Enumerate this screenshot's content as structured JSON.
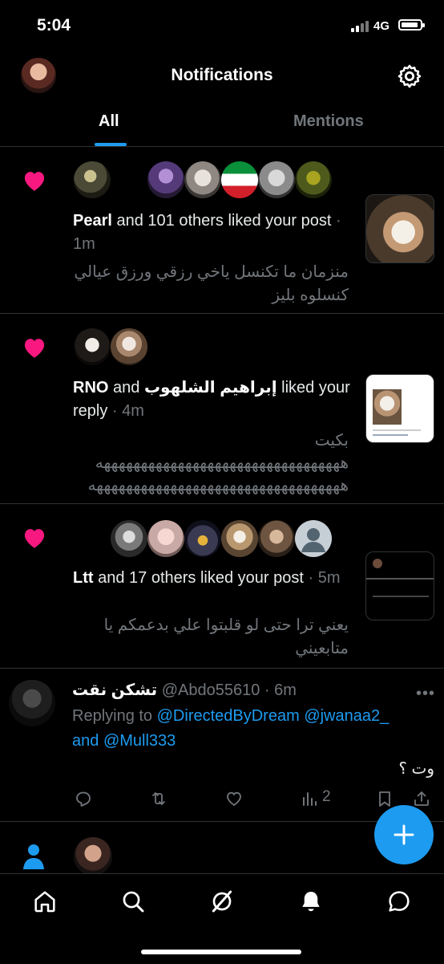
{
  "status_bar": {
    "time": "5:04",
    "network": "4G",
    "battery_level": 0.9
  },
  "header": {
    "title": "Notifications",
    "profile_icon": "avatar",
    "settings_icon": "gear-icon"
  },
  "tabs": [
    {
      "label": "All",
      "active": true
    },
    {
      "label": "Mentions",
      "active": false
    }
  ],
  "notifications": [
    {
      "icon": "heart-icon",
      "actor": "Pearl",
      "text_rest": " and 101 others liked your post",
      "time": " · 1m",
      "content": "منزمان ما تكنسل ياخي رزقي ورزق عيالي كنسلوه بليز"
    },
    {
      "icon": "heart-icon",
      "actor": "RNO",
      "mid": " and ",
      "actor2": "إبراهيم الشلهوب",
      "text_rest": " liked your reply",
      "time": " · 4m",
      "content_line1": "بكيت",
      "content_line2": "هههههههههههههههههههههههههههههههههه",
      "content_line3": "ههههههههههههههههههههههههههههههههههه"
    },
    {
      "icon": "heart-icon",
      "actor": "Ltt",
      "text_rest": " and 17 others liked your post",
      "time": " · 5m",
      "content": "يعني ترا حتى لو قلبتوا علي بدعمكم يا متابعيني"
    }
  ],
  "tweet": {
    "name": "تشكن نقت",
    "handle": "@Abdo55610",
    "time": " · 6m",
    "replying_prefix": "Replying to ",
    "reply_to_1": "@DirectedByDream",
    "reply_to_2": "@jwanaa2_",
    "reply_and": "and",
    "reply_to_3": "@Mull333",
    "body": "وت ؟",
    "views": "2"
  },
  "colors": {
    "accent": "#1d9bf0",
    "like": "#f91880",
    "muted": "#71767b",
    "divider": "#2f3336"
  }
}
